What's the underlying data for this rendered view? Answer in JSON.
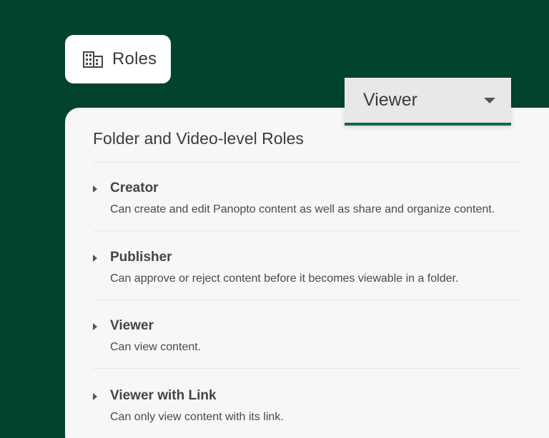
{
  "roles_chip": {
    "icon": "building-icon",
    "label": "Roles"
  },
  "role_dropdown": {
    "selected": "Viewer",
    "icon": "chevron-down-icon",
    "accent": "#0d6b4b"
  },
  "panel": {
    "title": "Folder and Video-level Roles",
    "roles": [
      {
        "name": "Creator",
        "description": "Can create and edit Panopto content as well as share and organize content."
      },
      {
        "name": "Publisher",
        "description": "Can approve or reject content before it becomes viewable in a folder."
      },
      {
        "name": "Viewer",
        "description": "Can view content."
      },
      {
        "name": "Viewer with Link",
        "description": "Can only view content with its link."
      }
    ]
  },
  "colors": {
    "background": "#024330",
    "panel": "#f7f7f7",
    "chip": "#ffffff"
  }
}
